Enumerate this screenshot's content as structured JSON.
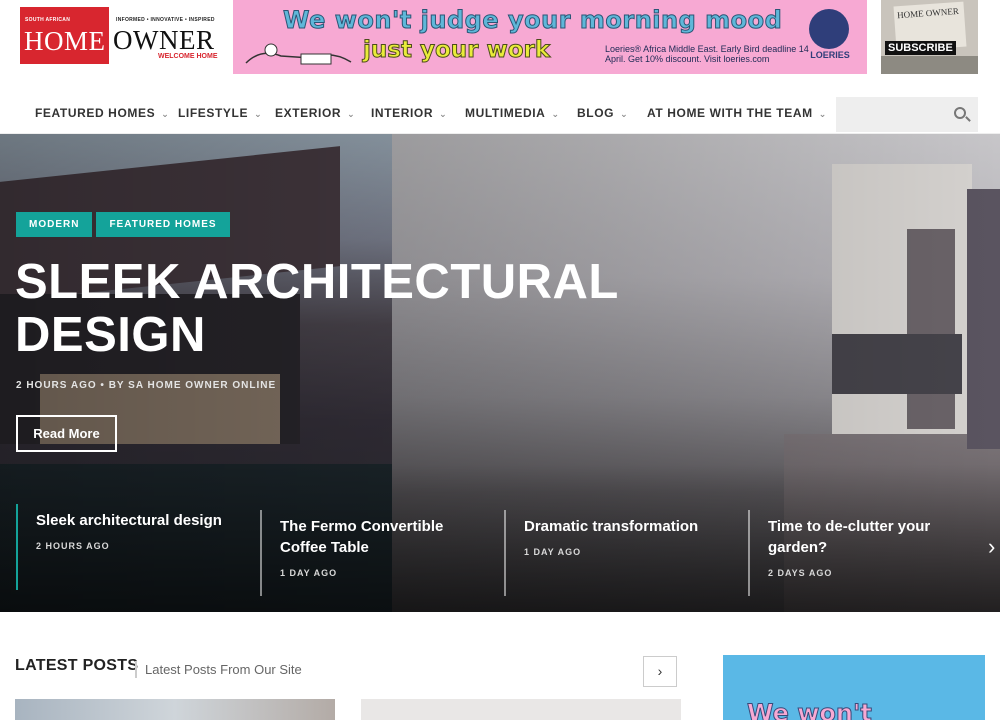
{
  "logo": {
    "sa": "SOUTH AFRICAN",
    "home": "HOME",
    "owner": "OWNER",
    "tagline": "INFORMED • INNOVATIVE • INSPIRED",
    "welcome": "WELCOME HOME"
  },
  "ad_top": {
    "line1": "We won't judge your morning mood",
    "line2": "just your work",
    "small": "Loeries® Africa Middle East. Early Bird deadline 14 April. Get 10% discount. Visit loeries.com",
    "badge_label": "LOERIES"
  },
  "magazine": {
    "cover_title": "HOME OWNER",
    "subscribe": "SUBSCRIBE"
  },
  "nav": {
    "items": [
      {
        "label": "FEATURED HOMES"
      },
      {
        "label": "LIFESTYLE"
      },
      {
        "label": "EXTERIOR"
      },
      {
        "label": "INTERIOR"
      },
      {
        "label": "MULTIMEDIA"
      },
      {
        "label": "BLOG"
      },
      {
        "label": "AT HOME WITH THE TEAM"
      }
    ],
    "chevron": "⌄"
  },
  "hero": {
    "categories": [
      "MODERN",
      "FEATURED HOMES"
    ],
    "title": "SLEEK ARCHITECTURAL DESIGN",
    "meta": "2 HOURS AGO  •  BY SA HOME OWNER ONLINE",
    "read_more": "Read More",
    "posts": [
      {
        "title": "Sleek architectural design",
        "time": "2 HOURS AGO"
      },
      {
        "title": "The Fermo Convertible Coffee Table",
        "time": "1 DAY AGO"
      },
      {
        "title": "Dramatic transformation",
        "time": "1 DAY AGO"
      },
      {
        "title": "Time to de-clutter your garden?",
        "time": "2 DAYS AGO"
      }
    ],
    "arrow": "›"
  },
  "latest": {
    "title": "LATEST POSTS",
    "subtitle": "Latest Posts From Our Site",
    "next": "›"
  },
  "ad_side": {
    "text": "We won't"
  },
  "colors": {
    "accent": "#14a39a",
    "brand_red": "#d8262f",
    "ad_pink": "#f7a9d3",
    "ad_blue": "#5ab8e6"
  }
}
